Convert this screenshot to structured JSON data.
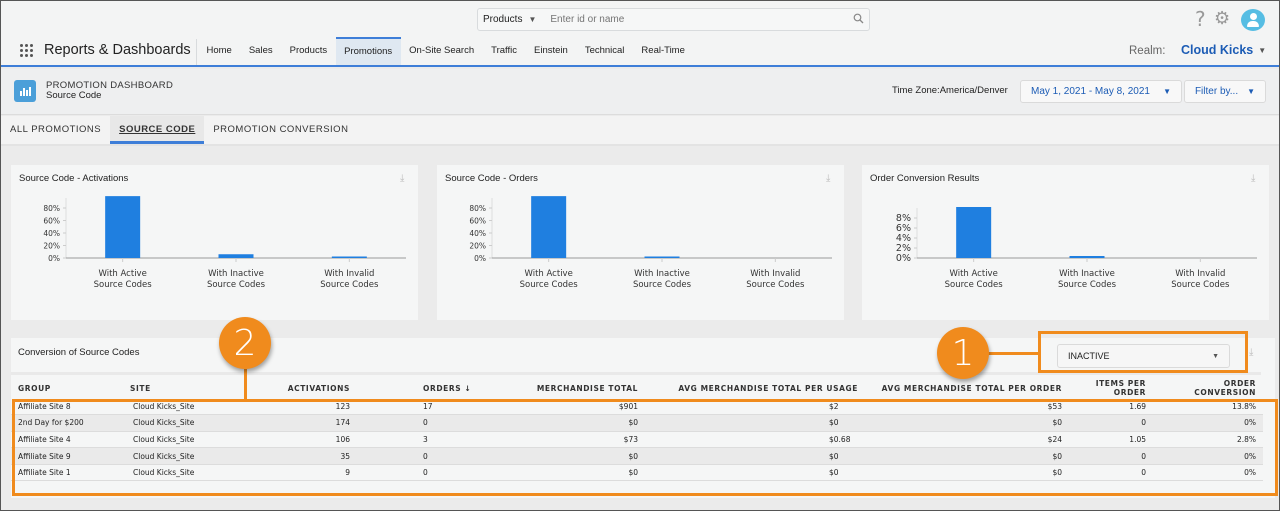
{
  "topbar": {
    "search_scope": "Products",
    "search_placeholder": "Enter id or name",
    "icons": [
      "search-icon",
      "help-icon",
      "gear-icon",
      "avatar-icon"
    ]
  },
  "navbar": {
    "app_name": "Reports & Dashboards",
    "items": [
      {
        "label": "Home",
        "active": false
      },
      {
        "label": "Sales",
        "active": false
      },
      {
        "label": "Products",
        "active": false
      },
      {
        "label": "Promotions",
        "active": true
      },
      {
        "label": "On-Site Search",
        "active": false
      },
      {
        "label": "Traffic",
        "active": false
      },
      {
        "label": "Einstein",
        "active": false
      },
      {
        "label": "Technical",
        "active": false
      },
      {
        "label": "Real-Time",
        "active": false
      }
    ],
    "realm_label": "Realm:",
    "realm_value": "Cloud Kicks"
  },
  "dashboard": {
    "title": "PROMOTION DASHBOARD",
    "subtitle": "Source Code",
    "timezone": "Time Zone:America/Denver",
    "date_range": "May 1, 2021 - May 8, 2021",
    "filter_label": "Filter by..."
  },
  "tabs": [
    {
      "label": "ALL PROMOTIONS",
      "active": false
    },
    {
      "label": "SOURCE CODE",
      "active": true
    },
    {
      "label": "PROMOTION CONVERSION",
      "active": false
    }
  ],
  "chart_data": [
    {
      "type": "bar",
      "title": "Source Code - Activations",
      "categories": [
        [
          "With Active",
          "Source Codes"
        ],
        [
          "With Inactive",
          "Source Codes"
        ],
        [
          "With Invalid",
          "Source Codes"
        ]
      ],
      "values": [
        99,
        6,
        2
      ],
      "yticks": [
        "0%",
        "20%",
        "40%",
        "60%",
        "80%"
      ],
      "ytick_values": [
        0,
        20,
        40,
        60,
        80
      ],
      "ylim": [
        0,
        100
      ],
      "xlabel": "",
      "ylabel": "",
      "color": "#1f7fe0"
    },
    {
      "type": "bar",
      "title": "Source Code - Orders",
      "categories": [
        [
          "With Active",
          "Source Codes"
        ],
        [
          "With Inactive",
          "Source Codes"
        ],
        [
          "With Invalid",
          "Source Codes"
        ]
      ],
      "values": [
        99,
        1,
        0
      ],
      "yticks": [
        "0%",
        "20%",
        "40%",
        "60%",
        "80%"
      ],
      "ytick_values": [
        0,
        20,
        40,
        60,
        80
      ],
      "ylim": [
        0,
        100
      ],
      "xlabel": "",
      "ylabel": "",
      "color": "#1f7fe0"
    },
    {
      "type": "bar",
      "title": "Order Conversion Results",
      "categories": [
        [
          "With Active",
          "Source Codes"
        ],
        [
          "With Inactive",
          "Source Codes"
        ],
        [
          "With Invalid",
          "Source Codes"
        ]
      ],
      "values": [
        10.2,
        0.4,
        0
      ],
      "yticks": [
        "0%",
        "2%",
        "4%",
        "6%",
        "8%"
      ],
      "ytick_values": [
        0,
        2,
        4,
        6,
        8
      ],
      "ylim": [
        0,
        10
      ],
      "xlabel": "",
      "ylabel": "",
      "color": "#1f7fe0"
    }
  ],
  "conversion_table": {
    "title": "Conversion of Source Codes",
    "filter_value": "INACTIVE",
    "columns": [
      "GROUP",
      "SITE",
      "ACTIVATIONS",
      "ORDERS ↓",
      "MERCHANDISE TOTAL",
      "AVG MERCHANDISE TOTAL PER USAGE",
      "AVG MERCHANDISE TOTAL PER ORDER",
      "ITEMS PER ORDER",
      "ORDER CONVERSION"
    ],
    "rows": [
      [
        "Affiliate Site 8",
        "Cloud Kicks_Site",
        "123",
        "17",
        "$901",
        "$2",
        "$53",
        "1.69",
        "13.8%"
      ],
      [
        "2nd Day for $200",
        "Cloud Kicks_Site",
        "174",
        "0",
        "$0",
        "$0",
        "$0",
        "0",
        "0%"
      ],
      [
        "Affiliate Site 4",
        "Cloud Kicks_Site",
        "106",
        "3",
        "$73",
        "$0.68",
        "$24",
        "1.05",
        "2.8%"
      ],
      [
        "Affiliate Site 9",
        "Cloud Kicks_Site",
        "35",
        "0",
        "$0",
        "$0",
        "$0",
        "0",
        "0%"
      ],
      [
        "Affiliate Site 1",
        "Cloud Kicks_Site",
        "9",
        "0",
        "$0",
        "$0",
        "$0",
        "0",
        "0%"
      ]
    ]
  },
  "callouts": {
    "one": "1",
    "two": "2"
  },
  "colors": {
    "accent": "#3e7ed8",
    "bar": "#1f7fe0",
    "callout": "#f08b1d",
    "realm": "#1c5cb5"
  }
}
